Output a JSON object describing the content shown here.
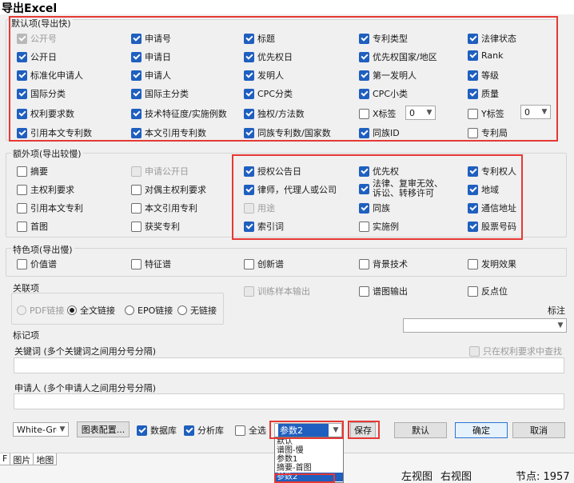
{
  "window": {
    "title": "导出Excel"
  },
  "groups": {
    "default": "默认项(导出快)",
    "extra": "额外项(导出较慢)",
    "special": "特色项(导出慢)",
    "related": "关联项",
    "mark": "标记项"
  },
  "default_items": [
    {
      "label": "公开号",
      "checked": true,
      "disabled": true
    },
    {
      "label": "申请号",
      "checked": true
    },
    {
      "label": "标题",
      "checked": true
    },
    {
      "label": "专利类型",
      "checked": true
    },
    {
      "label": "法律状态",
      "checked": true
    },
    {
      "label": "公开日",
      "checked": true
    },
    {
      "label": "申请日",
      "checked": true
    },
    {
      "label": "优先权日",
      "checked": true
    },
    {
      "label": "优先权国家/地区",
      "checked": true
    },
    {
      "label": "Rank",
      "checked": true
    },
    {
      "label": "标准化申请人",
      "checked": true
    },
    {
      "label": "申请人",
      "checked": true
    },
    {
      "label": "发明人",
      "checked": true
    },
    {
      "label": "第一发明人",
      "checked": true
    },
    {
      "label": "等级",
      "checked": true
    },
    {
      "label": "国际分类",
      "checked": true
    },
    {
      "label": "国际主分类",
      "checked": true
    },
    {
      "label": "CPC分类",
      "checked": true
    },
    {
      "label": "CPC小类",
      "checked": true
    },
    {
      "label": "质量",
      "checked": true
    },
    {
      "label": "权利要求数",
      "checked": true
    },
    {
      "label": "技术特征度/实施例数",
      "checked": true
    },
    {
      "label": "独权/方法数",
      "checked": true
    },
    {
      "label": "X标签",
      "checked": false
    },
    {
      "label": "Y标签",
      "checked": false
    },
    {
      "label": "引用本文专利数",
      "checked": true
    },
    {
      "label": "本文引用专利数",
      "checked": true
    },
    {
      "label": "同族专利数/国家数",
      "checked": true
    },
    {
      "label": "同族ID",
      "checked": true
    },
    {
      "label": "专利局",
      "checked": false
    }
  ],
  "x_tag_value": "0",
  "y_tag_value": "0",
  "extra_items": [
    {
      "label": "摘要",
      "checked": false
    },
    {
      "label": "申请公开日",
      "checked": false,
      "disabled": true
    },
    {
      "label": "授权公告日",
      "checked": true
    },
    {
      "label": "优先权",
      "checked": true
    },
    {
      "label": "专利权人",
      "checked": true
    },
    {
      "label": "主权利要求",
      "checked": false
    },
    {
      "label": "对偶主权利要求",
      "checked": false
    },
    {
      "label": "律师，代理人或公司",
      "checked": true
    },
    {
      "label": "法律、复审无效、诉讼、转移许可",
      "checked": true
    },
    {
      "label": "地域",
      "checked": true
    },
    {
      "label": "引用本文专利",
      "checked": false
    },
    {
      "label": "本文引用专利",
      "checked": false
    },
    {
      "label": "用途",
      "checked": false,
      "disabled": true
    },
    {
      "label": "同族",
      "checked": true
    },
    {
      "label": "通信地址",
      "checked": true
    },
    {
      "label": "首图",
      "checked": false
    },
    {
      "label": "获奖专利",
      "checked": false
    },
    {
      "label": "索引词",
      "checked": true
    },
    {
      "label": "实施例",
      "checked": false
    },
    {
      "label": "股票号码",
      "checked": true
    }
  ],
  "special_items": [
    {
      "label": "价值谱",
      "checked": false
    },
    {
      "label": "特征谱",
      "checked": false
    },
    {
      "label": "创新谱",
      "checked": false
    },
    {
      "label": "背景技术",
      "checked": false
    },
    {
      "label": "发明效果",
      "checked": false
    }
  ],
  "related": {
    "train_sample": "训练样本输出",
    "spectrum_output": "谱图输出",
    "anti_point": "反点位",
    "radios": [
      {
        "label": "PDF链接",
        "selected": false,
        "disabled": true
      },
      {
        "label": "全文链接",
        "selected": true
      },
      {
        "label": "EPO链接",
        "selected": false
      },
      {
        "label": "无链接",
        "selected": false
      }
    ],
    "annotation_label": "标注",
    "annotation_value": ""
  },
  "mark": {
    "keyword_label": "关键词 (多个关键词之间用分号分隔)",
    "only_in_claims": "只在权利要求中查找",
    "applicant_label": "申请人 (多个申请人之间用分号分隔)",
    "keyword_value": "",
    "applicant_value": ""
  },
  "footer": {
    "theme": "White-Gree",
    "chart_config": "图表配置...",
    "database": "数据库",
    "analysis": "分析库",
    "select_all": "全选",
    "param_value": "参数2",
    "save": "保存",
    "default": "默认",
    "ok": "确定",
    "cancel": "取消"
  },
  "param_options": [
    "默认",
    "谱图-慢",
    "参数1",
    "摘要-首图",
    "参数2"
  ],
  "status": {
    "tabs": [
      "F",
      "图片",
      "地图"
    ],
    "left_view": "左视图",
    "right_view": "右视图",
    "node": "节点: 1957"
  },
  "colors": {
    "accent": "#1f5fbf",
    "highlight": "#e53935"
  }
}
